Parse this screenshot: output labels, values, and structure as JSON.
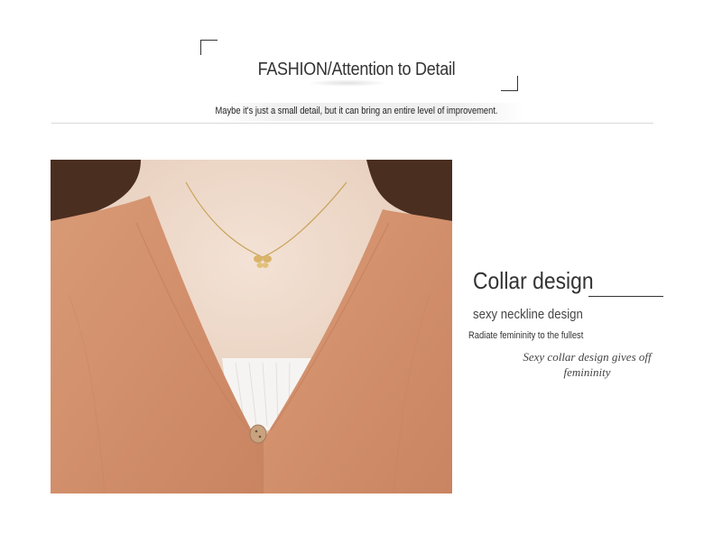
{
  "header": {
    "title": "FASHION/Attention to Detail",
    "tagline": "Maybe it's just a small detail, but it can bring an entire level of improvement."
  },
  "feature": {
    "title": "Collar design",
    "subtitle": "sexy neckline design",
    "note": "Radiate femininity to the fullest",
    "italic_caption": "Sexy collar design gives off femininity"
  },
  "colors": {
    "cardigan": "#d4906d",
    "skin": "#ecd8c9",
    "hair": "#4a2e20",
    "button": "#c9a27f",
    "text": "#333333"
  }
}
